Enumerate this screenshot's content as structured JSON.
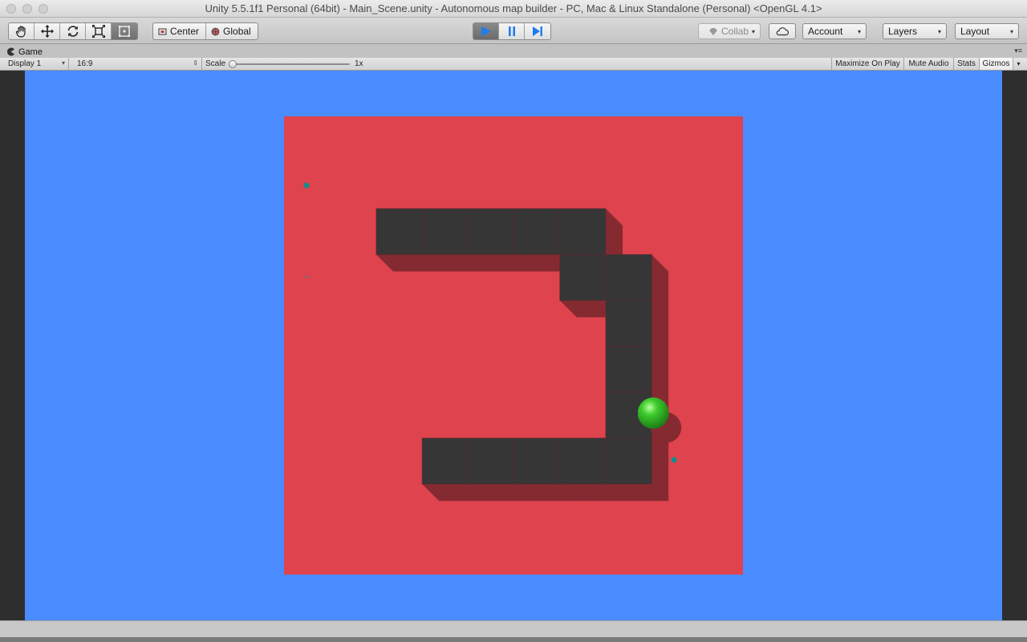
{
  "window": {
    "title": "Unity 5.5.1f1 Personal (64bit) - Main_Scene.unity - Autonomous map builder - PC, Mac & Linux Standalone (Personal) <OpenGL 4.1>"
  },
  "toolbar": {
    "transform_tools": [
      {
        "name": "hand-tool",
        "icon": "hand-icon",
        "active": false
      },
      {
        "name": "move-tool",
        "icon": "move-arrows-icon",
        "active": false
      },
      {
        "name": "rotate-tool",
        "icon": "rotate-icon",
        "active": false
      },
      {
        "name": "scale-tool",
        "icon": "scale-icon",
        "active": false
      },
      {
        "name": "rect-tool",
        "icon": "rect-icon",
        "active": true
      }
    ],
    "pivot_label": "Center",
    "space_label": "Global",
    "play_state": "playing",
    "collab_label": "Collab",
    "account_label": "Account",
    "layers_label": "Layers",
    "layout_label": "Layout"
  },
  "game_tab": {
    "label": "Game"
  },
  "game_view": {
    "display_label": "Display 1",
    "aspect_label": "16:9",
    "scale_label": "Scale",
    "scale_value_label": "1x",
    "scale_level": 0.0,
    "maximize_label": "Maximize On Play",
    "mute_label": "Mute Audio",
    "stats_label": "Stats",
    "gizmos_label": "Gizmos"
  },
  "colors": {
    "background_blue": "#4a8cff",
    "floor_red": "#df434d",
    "wall_block": "#363636",
    "wall_shadow": "#862a31",
    "agent_ball": "#3ecb2e",
    "agent_marker": "#0a0a80",
    "waypoint": "#0e8f8c",
    "play_active": "#1e7cf0"
  },
  "scene": {
    "wall_cells": [
      [
        0,
        0
      ],
      [
        1,
        0
      ],
      [
        2,
        0
      ],
      [
        3,
        0
      ],
      [
        4,
        0
      ],
      [
        4,
        1
      ],
      [
        5,
        1
      ],
      [
        5,
        2
      ],
      [
        5,
        3
      ],
      [
        5,
        4
      ],
      [
        1,
        5
      ],
      [
        2,
        5
      ],
      [
        3,
        5
      ],
      [
        4,
        5
      ],
      [
        5,
        5
      ]
    ],
    "agent_cell": [
      6,
      4
    ],
    "waypoints": [
      {
        "id": "wp1"
      },
      {
        "id": "wp2"
      },
      {
        "id": "wp3"
      }
    ]
  }
}
